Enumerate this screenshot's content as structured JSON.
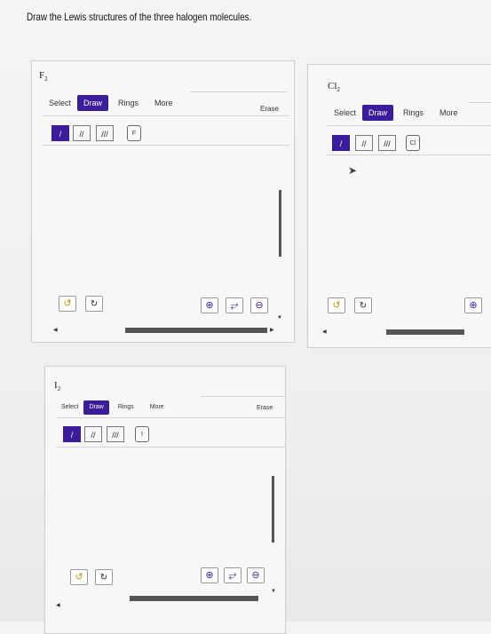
{
  "prompt": "Draw the Lewis structures of the three halogen molecules.",
  "panels": {
    "f2": {
      "symbol": "F",
      "subscript": "2",
      "tabs": {
        "select": "Select",
        "draw": "Draw",
        "rings": "Rings",
        "more": "More"
      },
      "erase": "Erase",
      "bonds": {
        "single": "/",
        "double": "//",
        "triple": "///"
      },
      "atom": "F"
    },
    "cl2": {
      "symbol": "Cl",
      "subscript": "2",
      "tabs": {
        "select": "Select",
        "draw": "Draw",
        "rings": "Rings",
        "more": "More"
      },
      "bonds": {
        "single": "/",
        "double": "//",
        "triple": "///"
      },
      "atom": "Cl"
    },
    "i2": {
      "symbol": "I",
      "subscript": "2",
      "tabs": {
        "select": "Select",
        "draw": "Draw",
        "rings": "Rings",
        "more": "More"
      },
      "erase": "Erase",
      "bonds": {
        "single": "/",
        "double": "//",
        "triple": "///"
      },
      "atom": "I"
    }
  },
  "icons": {
    "undo": "↺",
    "redo": "↻",
    "zoom_in": "⊕",
    "zoom_reset": "⥂",
    "zoom_out": "⊖"
  },
  "colors": {
    "accent": "#3b1c9a",
    "undo": "#c99500"
  }
}
